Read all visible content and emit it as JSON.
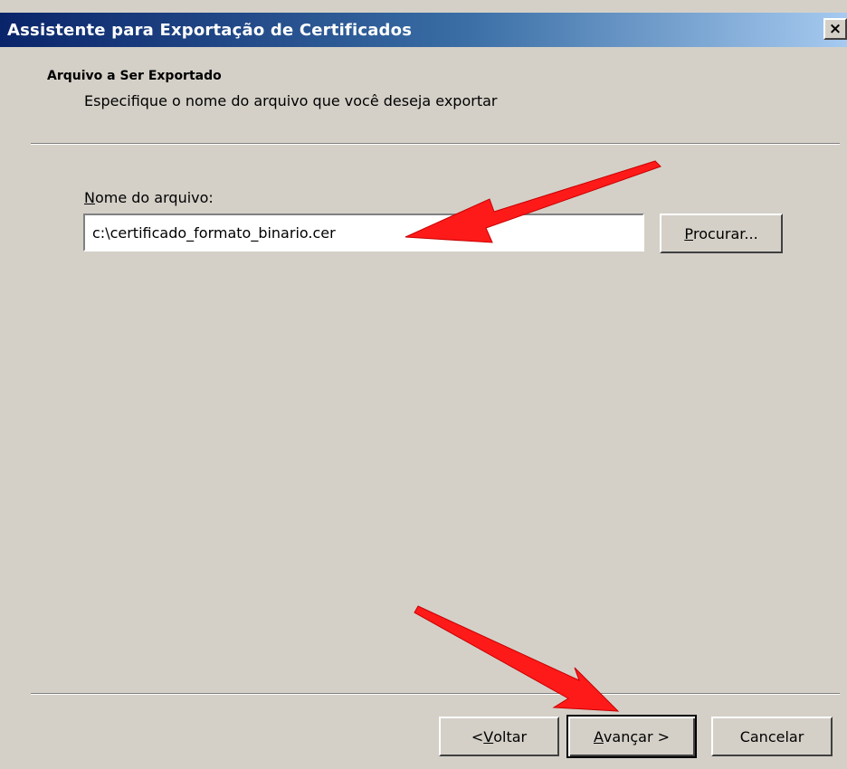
{
  "window": {
    "title": "Assistente para Exportação de Certificados",
    "close_label": "×"
  },
  "header": {
    "title": "Arquivo a Ser Exportado",
    "subtitle": "Especifique o nome do arquivo que você deseja exportar"
  },
  "form": {
    "label_mnemonic": "N",
    "label_rest": "ome do arquivo:",
    "file_value": "c:\\certificado_formato_binario.cer",
    "browse_mnemonic": "P",
    "browse_rest": "rocurar..."
  },
  "footer": {
    "back_prefix": "< ",
    "back_mnemonic": "V",
    "back_rest": "oltar",
    "next_mnemonic": "A",
    "next_rest": "vançar >",
    "cancel_label": "Cancelar"
  },
  "colors": {
    "dialog_bg": "#d4d0c8",
    "titlebar_start": "#0a246a",
    "titlebar_end": "#a6caf0",
    "annotation_arrow": "#ff1a1a"
  }
}
